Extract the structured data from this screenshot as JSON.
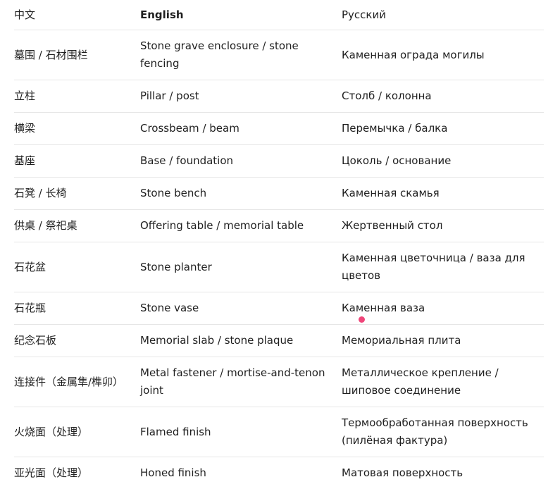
{
  "table": {
    "headers": {
      "zh": "中文",
      "en": "English",
      "ru": "Русский"
    },
    "rows": [
      {
        "zh": "墓围 / 石材围栏",
        "en": "Stone grave enclosure / stone fencing",
        "ru": "Каменная ограда могилы"
      },
      {
        "zh": "立柱",
        "en": "Pillar / post",
        "ru": "Столб / колонна"
      },
      {
        "zh": "横梁",
        "en": "Crossbeam / beam",
        "ru": "Перемычка / балка"
      },
      {
        "zh": "基座",
        "en": "Base / foundation",
        "ru": "Цоколь / основание"
      },
      {
        "zh": "石凳 / 长椅",
        "en": "Stone bench",
        "ru": "Каменная скамья"
      },
      {
        "zh": "供桌 / 祭祀桌",
        "en": "Offering table / memorial table",
        "ru": "Жертвенный стол"
      },
      {
        "zh": "石花盆",
        "en": "Stone planter",
        "ru": "Каменная цветочница / ваза для цветов"
      },
      {
        "zh": "石花瓶",
        "en": "Stone vase",
        "ru": "Каменная ваза"
      },
      {
        "zh": "纪念石板",
        "en": "Memorial slab / stone plaque",
        "ru": "Мемориальная плита"
      },
      {
        "zh": "连接件（金属隼/榫卯）",
        "en": "Metal fastener / mortise-and-tenon joint",
        "ru": "Металлическое крепление / шиповое соединение"
      },
      {
        "zh": "火烧面（处理）",
        "en": "Flamed finish",
        "ru": "Термообработанная поверхность (пилёная фактура)"
      },
      {
        "zh": "亚光面（处理）",
        "en": "Honed finish",
        "ru": "Матовая поверхность"
      }
    ]
  },
  "colors": {
    "cursor_dot": "#f0467a",
    "divider": "#e6e6e6",
    "text": "#1f1f1f"
  }
}
